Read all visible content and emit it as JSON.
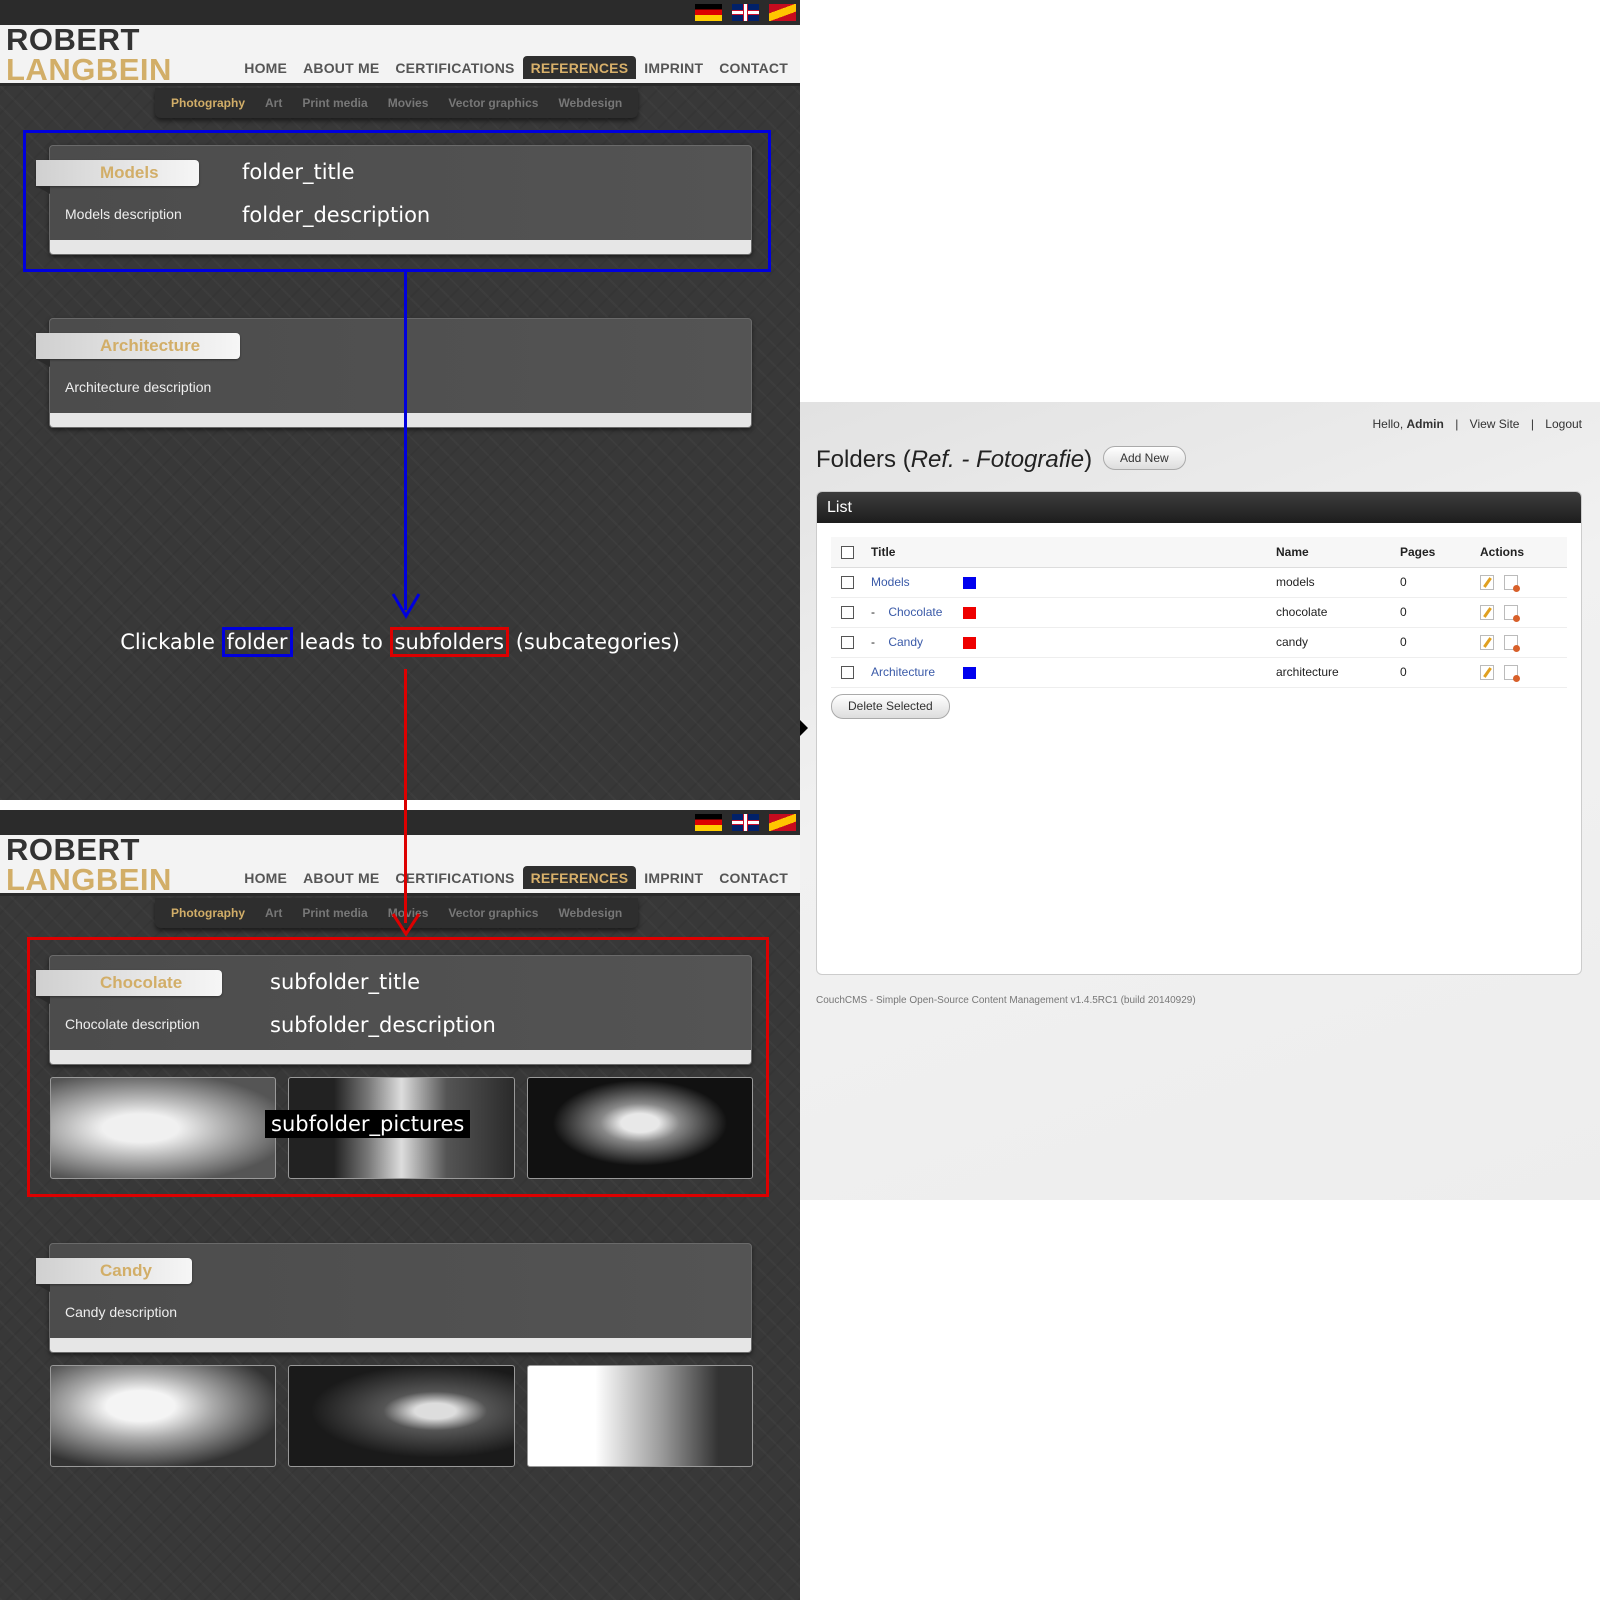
{
  "site": {
    "logo_line1": "ROBERT",
    "logo_line2": "LANGBEIN",
    "nav": [
      "HOME",
      "ABOUT ME",
      "CERTIFICATIONS",
      "REFERENCES",
      "IMPRINT",
      "CONTACT"
    ],
    "nav_active": "REFERENCES",
    "subnav": [
      "Photography",
      "Art",
      "Print media",
      "Movies",
      "Vector graphics",
      "Webdesign"
    ],
    "subnav_active": "Photography",
    "flags": [
      "de-flag-icon",
      "uk-flag-icon",
      "es-flag-icon"
    ]
  },
  "top_page": {
    "cards": [
      {
        "title": "Models",
        "description": "Models description"
      },
      {
        "title": "Architecture",
        "description": "Architecture description"
      }
    ],
    "annotations": {
      "title": "folder_title",
      "description": "folder_description"
    }
  },
  "explanation": {
    "part1": "Clickable",
    "folder": "folder",
    "part2": "leads to",
    "subfolders": "subfolders",
    "part3": "(subcategories)"
  },
  "bottom_page": {
    "cards": [
      {
        "title": "Chocolate",
        "description": "Chocolate description"
      },
      {
        "title": "Candy",
        "description": "Candy description"
      }
    ],
    "annotations": {
      "title": "subfolder_title",
      "description": "subfolder_description",
      "pictures": "subfolder_pictures"
    }
  },
  "admin": {
    "greeting": "Hello,",
    "user": "Admin",
    "view_site": "View Site",
    "logout": "Logout",
    "title_prefix": "Folders (",
    "title_italic": "Ref. - Fotografie",
    "title_suffix": ")",
    "add_new": "Add New",
    "list_heading": "List",
    "columns": [
      "Title",
      "Name",
      "Pages",
      "Actions"
    ],
    "rows": [
      {
        "title": "Models",
        "indent": "",
        "name": "models",
        "pages": "0",
        "color": "#0000ee"
      },
      {
        "title": "Chocolate",
        "indent": "-",
        "name": "chocolate",
        "pages": "0",
        "color": "#ee0000"
      },
      {
        "title": "Candy",
        "indent": "-",
        "name": "candy",
        "pages": "0",
        "color": "#ee0000"
      },
      {
        "title": "Architecture",
        "indent": "",
        "name": "architecture",
        "pages": "0",
        "color": "#0000ee"
      }
    ],
    "delete_selected": "Delete Selected",
    "footer": "CouchCMS - Simple Open-Source Content Management v1.4.5RC1 (build 20140929)"
  },
  "colors": {
    "accent_gold": "#d2ae68",
    "folder_highlight": "#0000dd",
    "subfolder_highlight": "#dd0000"
  }
}
